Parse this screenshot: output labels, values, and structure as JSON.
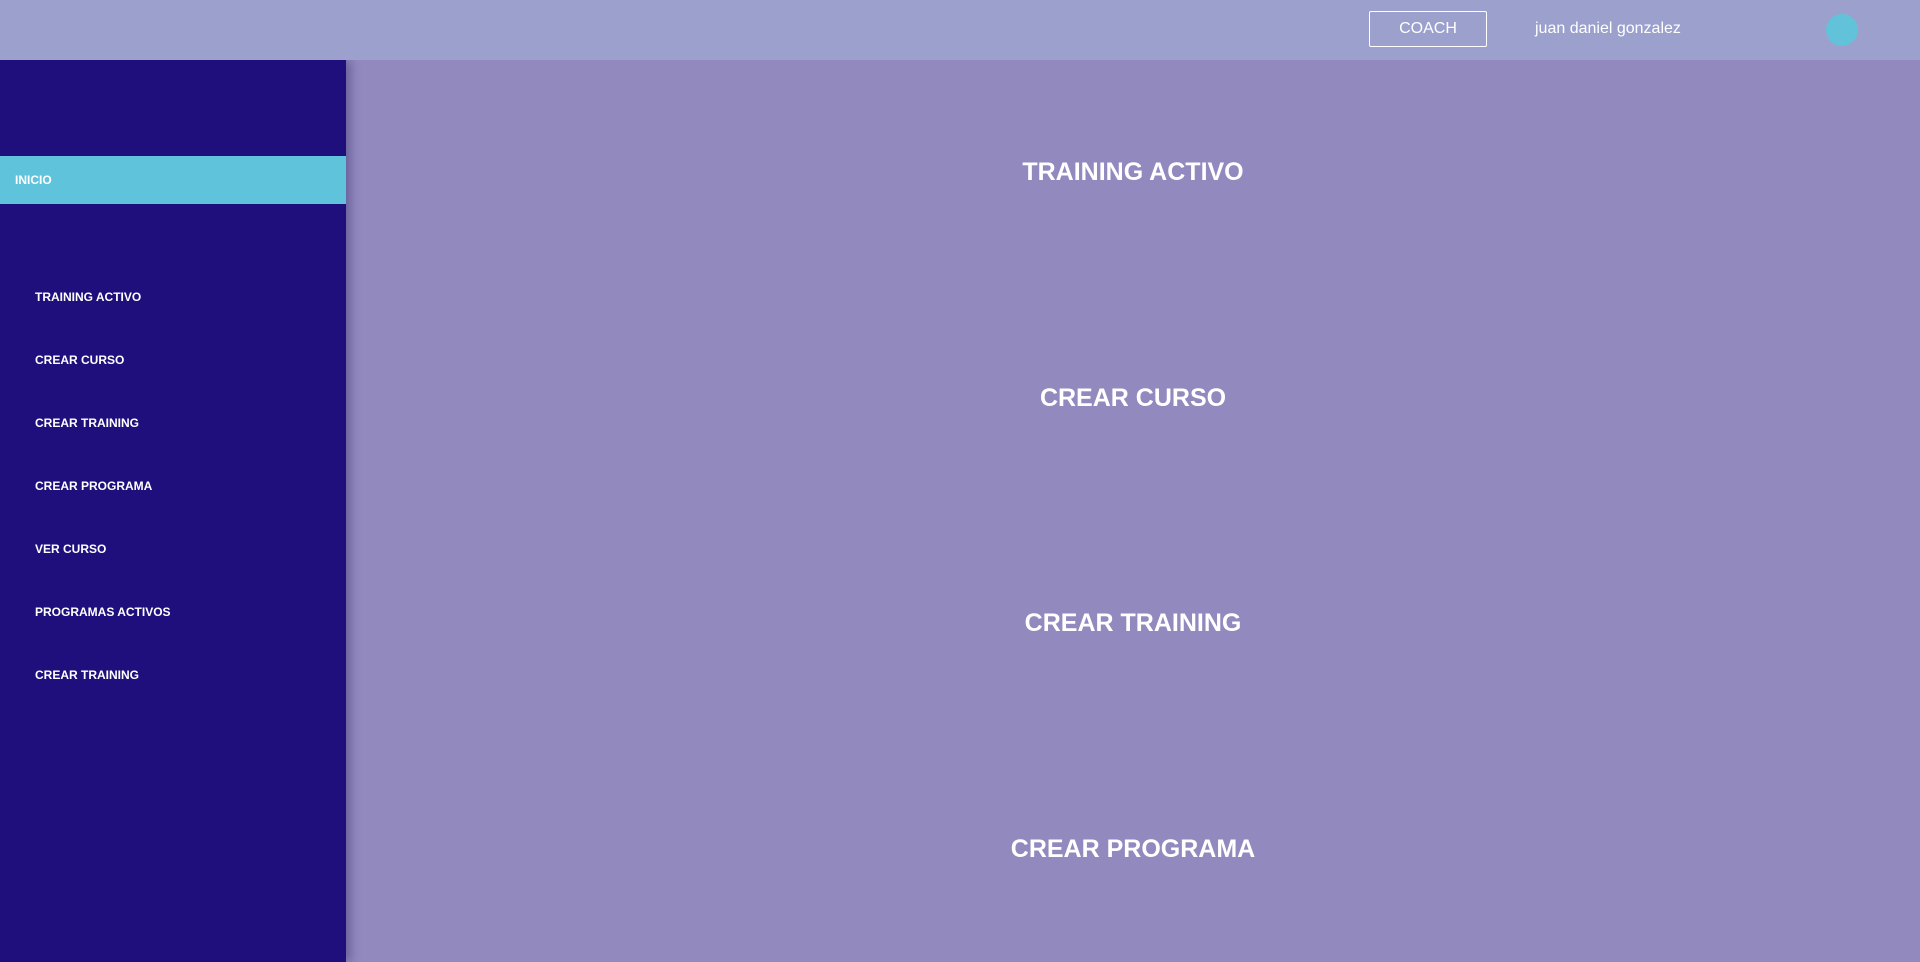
{
  "header": {
    "role_button": "COACH",
    "user_name": "juan daniel gonzalez"
  },
  "sidebar": {
    "active_item": "INICIO",
    "items": [
      {
        "label": "TRAINING ACTIVO"
      },
      {
        "label": "CREAR CURSO"
      },
      {
        "label": "CREAR TRAINING"
      },
      {
        "label": "CREAR PROGRAMA"
      },
      {
        "label": "VER CURSO"
      },
      {
        "label": "PROGRAMAS ACTIVOS"
      },
      {
        "label": "CREAR TRAINING"
      }
    ]
  },
  "main": {
    "sections": [
      {
        "title": "TRAINING ACTIVO"
      },
      {
        "title": "CREAR CURSO"
      },
      {
        "title": "CREAR TRAINING"
      },
      {
        "title": "CREAR PROGRAMA"
      }
    ]
  },
  "colors": {
    "topbar": "#9ba0cd",
    "sidebar": "#1f0f7c",
    "active_item": "#60c3dc",
    "main_background": "#9289bf",
    "avatar": "#62c2da"
  }
}
